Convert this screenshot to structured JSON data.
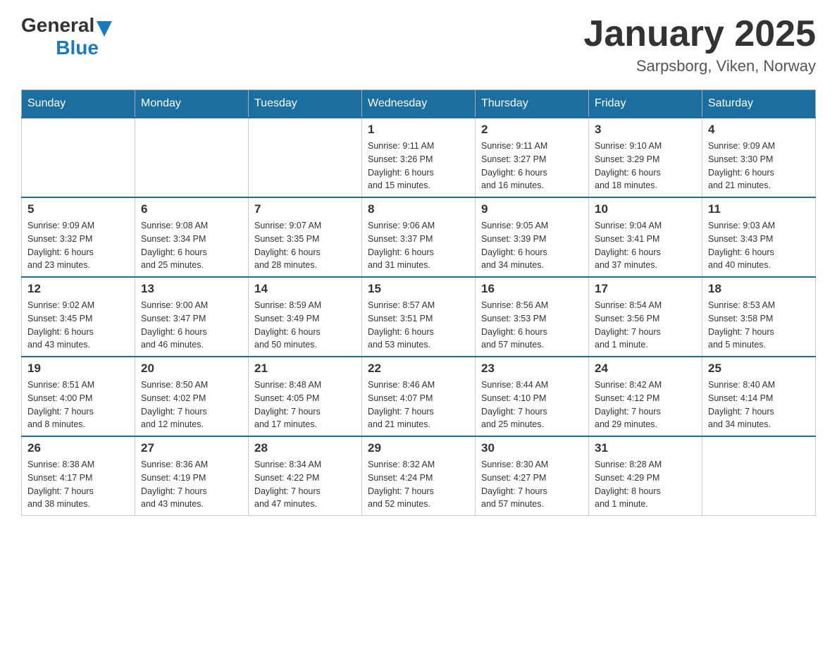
{
  "logo": {
    "general": "General",
    "blue": "Blue"
  },
  "title": "January 2025",
  "location": "Sarpsborg, Viken, Norway",
  "days_of_week": [
    "Sunday",
    "Monday",
    "Tuesday",
    "Wednesday",
    "Thursday",
    "Friday",
    "Saturday"
  ],
  "weeks": [
    [
      {
        "day": "",
        "info": ""
      },
      {
        "day": "",
        "info": ""
      },
      {
        "day": "",
        "info": ""
      },
      {
        "day": "1",
        "info": "Sunrise: 9:11 AM\nSunset: 3:26 PM\nDaylight: 6 hours\nand 15 minutes."
      },
      {
        "day": "2",
        "info": "Sunrise: 9:11 AM\nSunset: 3:27 PM\nDaylight: 6 hours\nand 16 minutes."
      },
      {
        "day": "3",
        "info": "Sunrise: 9:10 AM\nSunset: 3:29 PM\nDaylight: 6 hours\nand 18 minutes."
      },
      {
        "day": "4",
        "info": "Sunrise: 9:09 AM\nSunset: 3:30 PM\nDaylight: 6 hours\nand 21 minutes."
      }
    ],
    [
      {
        "day": "5",
        "info": "Sunrise: 9:09 AM\nSunset: 3:32 PM\nDaylight: 6 hours\nand 23 minutes."
      },
      {
        "day": "6",
        "info": "Sunrise: 9:08 AM\nSunset: 3:34 PM\nDaylight: 6 hours\nand 25 minutes."
      },
      {
        "day": "7",
        "info": "Sunrise: 9:07 AM\nSunset: 3:35 PM\nDaylight: 6 hours\nand 28 minutes."
      },
      {
        "day": "8",
        "info": "Sunrise: 9:06 AM\nSunset: 3:37 PM\nDaylight: 6 hours\nand 31 minutes."
      },
      {
        "day": "9",
        "info": "Sunrise: 9:05 AM\nSunset: 3:39 PM\nDaylight: 6 hours\nand 34 minutes."
      },
      {
        "day": "10",
        "info": "Sunrise: 9:04 AM\nSunset: 3:41 PM\nDaylight: 6 hours\nand 37 minutes."
      },
      {
        "day": "11",
        "info": "Sunrise: 9:03 AM\nSunset: 3:43 PM\nDaylight: 6 hours\nand 40 minutes."
      }
    ],
    [
      {
        "day": "12",
        "info": "Sunrise: 9:02 AM\nSunset: 3:45 PM\nDaylight: 6 hours\nand 43 minutes."
      },
      {
        "day": "13",
        "info": "Sunrise: 9:00 AM\nSunset: 3:47 PM\nDaylight: 6 hours\nand 46 minutes."
      },
      {
        "day": "14",
        "info": "Sunrise: 8:59 AM\nSunset: 3:49 PM\nDaylight: 6 hours\nand 50 minutes."
      },
      {
        "day": "15",
        "info": "Sunrise: 8:57 AM\nSunset: 3:51 PM\nDaylight: 6 hours\nand 53 minutes."
      },
      {
        "day": "16",
        "info": "Sunrise: 8:56 AM\nSunset: 3:53 PM\nDaylight: 6 hours\nand 57 minutes."
      },
      {
        "day": "17",
        "info": "Sunrise: 8:54 AM\nSunset: 3:56 PM\nDaylight: 7 hours\nand 1 minute."
      },
      {
        "day": "18",
        "info": "Sunrise: 8:53 AM\nSunset: 3:58 PM\nDaylight: 7 hours\nand 5 minutes."
      }
    ],
    [
      {
        "day": "19",
        "info": "Sunrise: 8:51 AM\nSunset: 4:00 PM\nDaylight: 7 hours\nand 8 minutes."
      },
      {
        "day": "20",
        "info": "Sunrise: 8:50 AM\nSunset: 4:02 PM\nDaylight: 7 hours\nand 12 minutes."
      },
      {
        "day": "21",
        "info": "Sunrise: 8:48 AM\nSunset: 4:05 PM\nDaylight: 7 hours\nand 17 minutes."
      },
      {
        "day": "22",
        "info": "Sunrise: 8:46 AM\nSunset: 4:07 PM\nDaylight: 7 hours\nand 21 minutes."
      },
      {
        "day": "23",
        "info": "Sunrise: 8:44 AM\nSunset: 4:10 PM\nDaylight: 7 hours\nand 25 minutes."
      },
      {
        "day": "24",
        "info": "Sunrise: 8:42 AM\nSunset: 4:12 PM\nDaylight: 7 hours\nand 29 minutes."
      },
      {
        "day": "25",
        "info": "Sunrise: 8:40 AM\nSunset: 4:14 PM\nDaylight: 7 hours\nand 34 minutes."
      }
    ],
    [
      {
        "day": "26",
        "info": "Sunrise: 8:38 AM\nSunset: 4:17 PM\nDaylight: 7 hours\nand 38 minutes."
      },
      {
        "day": "27",
        "info": "Sunrise: 8:36 AM\nSunset: 4:19 PM\nDaylight: 7 hours\nand 43 minutes."
      },
      {
        "day": "28",
        "info": "Sunrise: 8:34 AM\nSunset: 4:22 PM\nDaylight: 7 hours\nand 47 minutes."
      },
      {
        "day": "29",
        "info": "Sunrise: 8:32 AM\nSunset: 4:24 PM\nDaylight: 7 hours\nand 52 minutes."
      },
      {
        "day": "30",
        "info": "Sunrise: 8:30 AM\nSunset: 4:27 PM\nDaylight: 7 hours\nand 57 minutes."
      },
      {
        "day": "31",
        "info": "Sunrise: 8:28 AM\nSunset: 4:29 PM\nDaylight: 8 hours\nand 1 minute."
      },
      {
        "day": "",
        "info": ""
      }
    ]
  ]
}
